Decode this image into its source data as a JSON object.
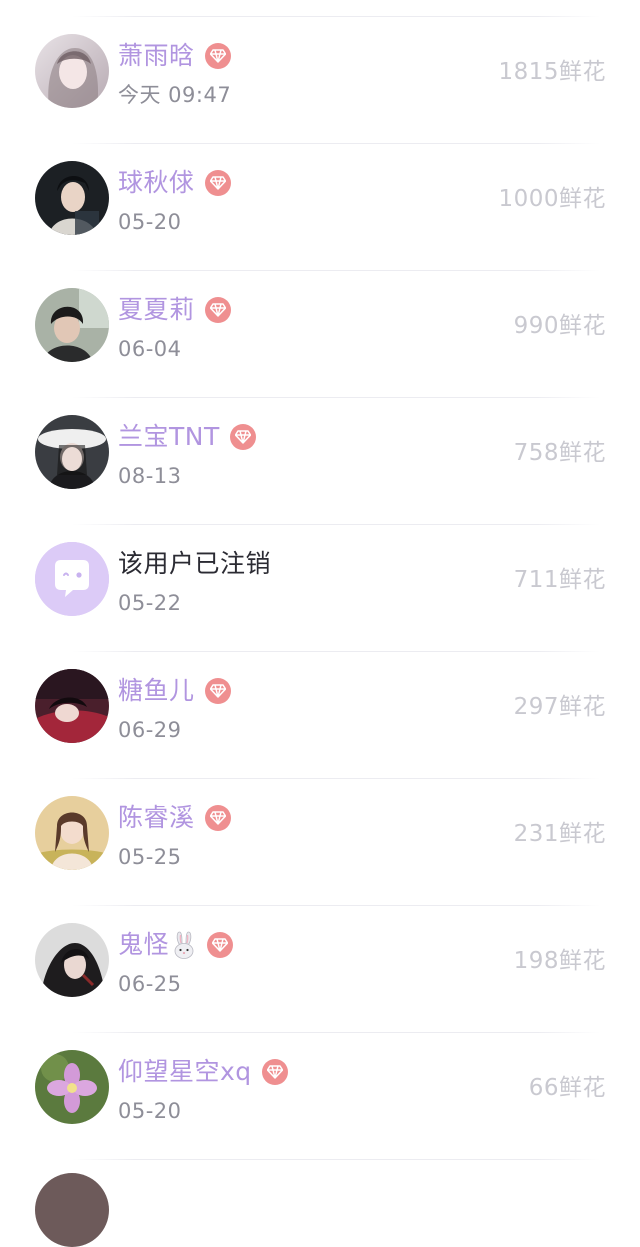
{
  "items": [
    {
      "name": "萧雨晗",
      "date": "今天 09:47",
      "flowers": "1815鲜花",
      "vip": true,
      "avatar_icon": "user-avatar-photo"
    },
    {
      "name": "球秋俅",
      "date": "05-20",
      "flowers": "1000鲜花",
      "vip": true,
      "avatar_icon": "user-avatar-photo"
    },
    {
      "name": "夏夏莉",
      "date": "06-04",
      "flowers": "990鲜花",
      "vip": true,
      "avatar_icon": "user-avatar-photo"
    },
    {
      "name": "兰宝TNT",
      "date": "08-13",
      "flowers": "758鲜花",
      "vip": true,
      "avatar_icon": "user-avatar-photo"
    },
    {
      "name": "该用户已注销",
      "date": "05-22",
      "flowers": "711鲜花",
      "vip": false,
      "avatar_icon": "chat-bubble-icon"
    },
    {
      "name": "糖鱼儿",
      "date": "06-29",
      "flowers": "297鲜花",
      "vip": true,
      "avatar_icon": "user-avatar-photo"
    },
    {
      "name": "陈睿溪",
      "date": "05-25",
      "flowers": "231鲜花",
      "vip": true,
      "avatar_icon": "user-avatar-photo"
    },
    {
      "name": "鬼怪",
      "date": "06-25",
      "flowers": "198鲜花",
      "vip": true,
      "avatar_icon": "user-avatar-photo",
      "name_emoji": "rabbit-emoji"
    },
    {
      "name": "仰望星空xq",
      "date": "05-20",
      "flowers": "66鲜花",
      "vip": true,
      "avatar_icon": "user-avatar-photo"
    }
  ],
  "colors": {
    "name_purple": "#b195e0",
    "cancelled_name": "#2b2b33",
    "vip_badge": "#ef8f90",
    "date_gray": "#8e8e98",
    "flowers_gray": "#c9c9d0",
    "cancelled_avatar_bg": "#dccbf7"
  }
}
